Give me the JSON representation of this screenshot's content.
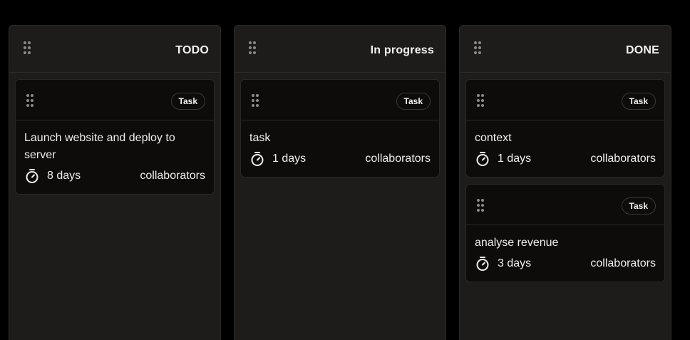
{
  "columns": [
    {
      "title": "TODO",
      "cards": [
        {
          "badge": "Task",
          "title": "Launch website and deploy to server",
          "duration": "8 days",
          "collaborators": "collaborators"
        }
      ]
    },
    {
      "title": "In progress",
      "cards": [
        {
          "badge": "Task",
          "title": "task",
          "duration": "1 days",
          "collaborators": "collaborators"
        }
      ]
    },
    {
      "title": "DONE",
      "cards": [
        {
          "badge": "Task",
          "title": "context",
          "duration": "1 days",
          "collaborators": "collaborators"
        },
        {
          "badge": "Task",
          "title": "analyse revenue",
          "duration": "3 days",
          "collaborators": "collaborators"
        }
      ]
    }
  ],
  "icons": {
    "drag": "drag-handle-icon",
    "timer": "stopwatch-icon"
  },
  "colors": {
    "background": "#000000",
    "column": "#1e1c1a",
    "card": "#0d0c0b",
    "text": "#f2f0ee"
  }
}
